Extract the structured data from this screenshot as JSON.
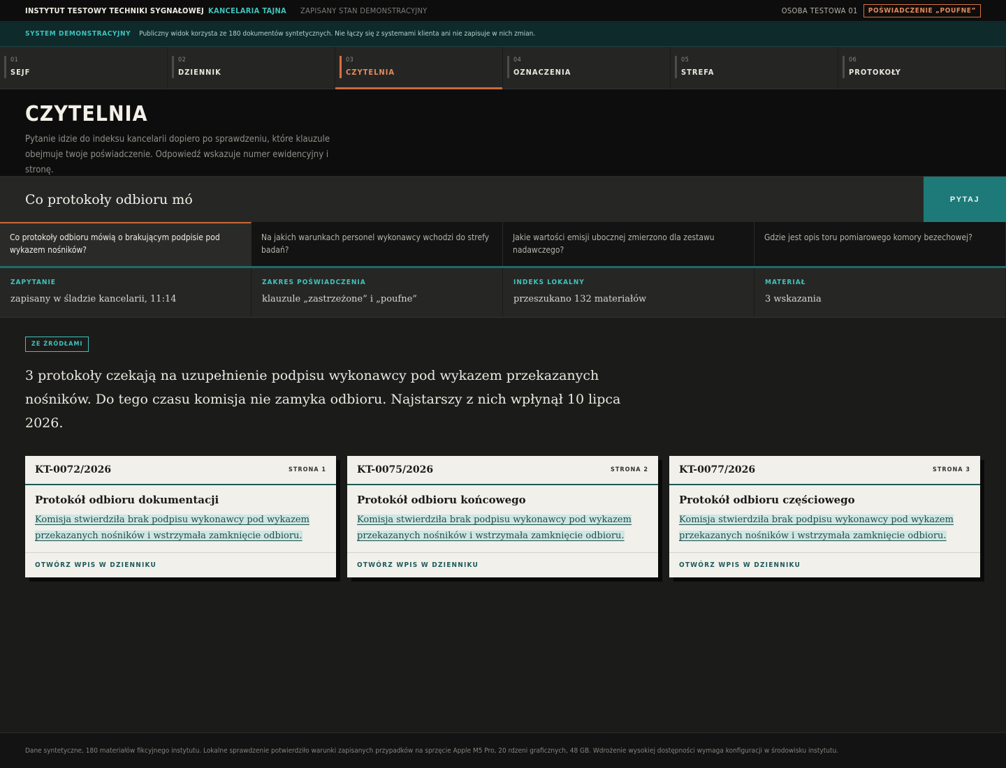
{
  "topbar": {
    "org": "INSTYTUT TESTOWY TECHNIKI SYGNAŁOWEJ",
    "org_accent": "KANCELARIA TAJNA",
    "state": "ZAPISANY STAN DEMONSTRACYJNY",
    "user": "OSOBA TESTOWA 01",
    "clearance": "POŚWIADCZENIE „POUFNE”"
  },
  "banner": {
    "tag": "SYSTEM DEMONSTRACYJNY",
    "message": "Publiczny widok korzysta ze 180 dokumentów syntetycznych. Nie łączy się z systemami klienta ani nie zapisuje w nich zmian."
  },
  "tabs": [
    {
      "num": "01",
      "label": "SEJF"
    },
    {
      "num": "02",
      "label": "DZIENNIK"
    },
    {
      "num": "03",
      "label": "CZYTELNIA"
    },
    {
      "num": "04",
      "label": "OZNACZENIA"
    },
    {
      "num": "05",
      "label": "STREFA"
    },
    {
      "num": "06",
      "label": "PROTOKOŁY"
    }
  ],
  "hero": {
    "title": "CZYTELNIA",
    "description": "Pytanie idzie do indeksu kancelarii dopiero po sprawdzeniu, które klauzule obejmuje twoje poświadczenie. Odpowiedź wskazuje numer ewidencyjny i stronę."
  },
  "query": {
    "value": "Co protokoły odbioru mó",
    "button": "PYTAJ"
  },
  "suggestions": [
    "Co protokoły odbioru mówią o brakującym podpisie pod wykazem nośników?",
    "Na jakich warunkach personel wykonawcy wchodzi do strefy badań?",
    "Jakie wartości emisji ubocznej zmierzono dla zestawu nadawczego?",
    "Gdzie jest opis toru pomiarowego komory bezechowej?"
  ],
  "meta": [
    {
      "key": "ZAPYTANIE",
      "value": "zapisany w śladzie kancelarii, 11:14"
    },
    {
      "key": "ZAKRES POŚWIADCZENIA",
      "value": "klauzule „zastrzeżone” i „poufne”"
    },
    {
      "key": "INDEKS LOKALNY",
      "value": "przeszukano 132 materiałów"
    },
    {
      "key": "MATERIAŁ",
      "value": "3 wskazania"
    }
  ],
  "answer": {
    "badge": "ZE ŹRÓDŁAMI",
    "text": "3 protokoły czekają na uzupełnienie podpisu wykonawcy pod wykazem przekazanych nośników. Do tego czasu komisja nie zamyka odbioru. Najstarszy z nich wpłynął 10 lipca 2026."
  },
  "cards": [
    {
      "id": "KT-0072/2026",
      "page": "STRONA 1",
      "title": "Protokół odbioru dokumentacji",
      "quote": "Komisja stwierdziła brak podpisu wykonawcy pod wykazem przekazanych nośników i wstrzymała zamknięcie odbioru.",
      "link": "OTWÓRZ WPIS W DZIENNIKU"
    },
    {
      "id": "KT-0075/2026",
      "page": "STRONA 2",
      "title": "Protokół odbioru końcowego",
      "quote": "Komisja stwierdziła brak podpisu wykonawcy pod wykazem przekazanych nośników i wstrzymała zamknięcie odbioru.",
      "link": "OTWÓRZ WPIS W DZIENNIKU"
    },
    {
      "id": "KT-0077/2026",
      "page": "STRONA 3",
      "title": "Protokół odbioru częściowego",
      "quote": "Komisja stwierdziła brak podpisu wykonawcy pod wykazem przekazanych nośników i wstrzymała zamknięcie odbioru.",
      "link": "OTWÓRZ WPIS W DZIENNIKU"
    }
  ],
  "footer": {
    "text": "Dane syntetyczne, 180 materiałów fikcyjnego instytutu. Lokalne sprawdzenie potwierdziło warunki zapisanych przypadków na sprzęcie Apple M5 Pro, 20 rdzeni graficznych, 48 GB. Wdrożenie wysokiej dostępności wymaga konfiguracji w środowisku instytutu."
  }
}
